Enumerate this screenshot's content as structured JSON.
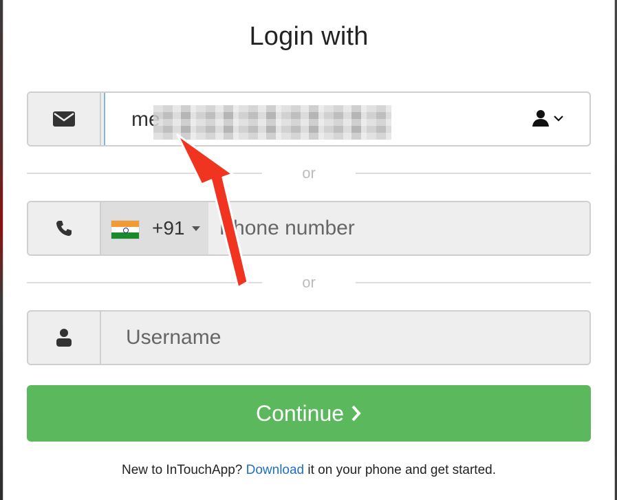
{
  "title": "Login with",
  "email": {
    "visible_value": "me",
    "icon": "envelope-icon",
    "contact_picker_icon": "person-chevron-icon"
  },
  "separators": [
    "or",
    "or"
  ],
  "phone": {
    "icon": "phone-icon",
    "country_code": "+91",
    "flag": "india-flag-icon",
    "placeholder": "Phone number"
  },
  "username": {
    "icon": "user-icon",
    "placeholder": "Username"
  },
  "continue_button": {
    "label": "Continue",
    "icon": "chevron-right-icon",
    "color": "#5cb85c"
  },
  "footer": {
    "prefix": "New to InTouchApp?",
    "link": "Download",
    "suffix": "it on your phone and get started."
  },
  "colors": {
    "focus_border": "#7fb6e6",
    "arrow": "#f0341f",
    "link": "#1f6fc5"
  }
}
